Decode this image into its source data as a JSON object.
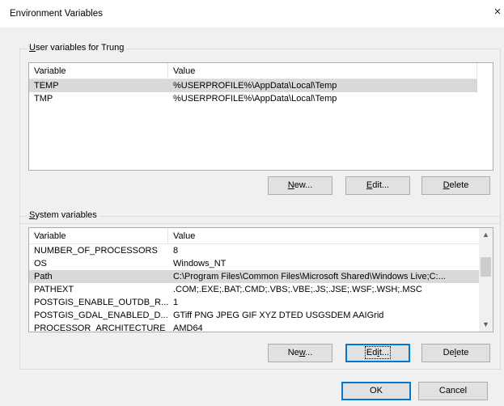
{
  "window": {
    "title": "Environment Variables",
    "close_glyph": "×"
  },
  "user_group": {
    "label_prefix": "U",
    "label_rest": "ser variables for Trung",
    "columns": [
      "Variable",
      "Value"
    ],
    "rows": [
      {
        "name": "TEMP",
        "value": "%USERPROFILE%\\AppData\\Local\\Temp"
      },
      {
        "name": "TMP",
        "value": "%USERPROFILE%\\AppData\\Local\\Temp"
      }
    ],
    "buttons": {
      "new": {
        "a": "",
        "u": "N",
        "b": "ew..."
      },
      "edit": {
        "a": "",
        "u": "E",
        "b": "dit..."
      },
      "delete": {
        "a": "",
        "u": "D",
        "b": "elete"
      }
    }
  },
  "system_group": {
    "label_prefix": "S",
    "label_rest": "ystem variables",
    "columns": [
      "Variable",
      "Value"
    ],
    "rows": [
      {
        "name": "NUMBER_OF_PROCESSORS",
        "value": "8"
      },
      {
        "name": "OS",
        "value": "Windows_NT"
      },
      {
        "name": "Path",
        "value": "C:\\Program Files\\Common Files\\Microsoft Shared\\Windows Live;C:..."
      },
      {
        "name": "PATHEXT",
        "value": ".COM;.EXE;.BAT;.CMD;.VBS;.VBE;.JS;.JSE;.WSF;.WSH;.MSC"
      },
      {
        "name": "POSTGIS_ENABLE_OUTDB_R...",
        "value": "1"
      },
      {
        "name": "POSTGIS_GDAL_ENABLED_D...",
        "value": "GTiff PNG JPEG GIF XYZ DTED USGSDEM AAIGrid"
      },
      {
        "name": "PROCESSOR_ARCHITECTURE",
        "value": "AMD64"
      }
    ],
    "buttons": {
      "new": {
        "a": "Ne",
        "u": "w",
        "b": "..."
      },
      "edit": {
        "a": "Ed",
        "u": "i",
        "b": "t..."
      },
      "delete": {
        "a": "De",
        "u": "l",
        "b": "ete"
      }
    }
  },
  "footer": {
    "ok": "OK",
    "cancel": "Cancel"
  },
  "colors": {
    "selection": "#d9d9d9",
    "focus_border": "#0078d7",
    "dialog_bg": "#f0f0f0"
  }
}
